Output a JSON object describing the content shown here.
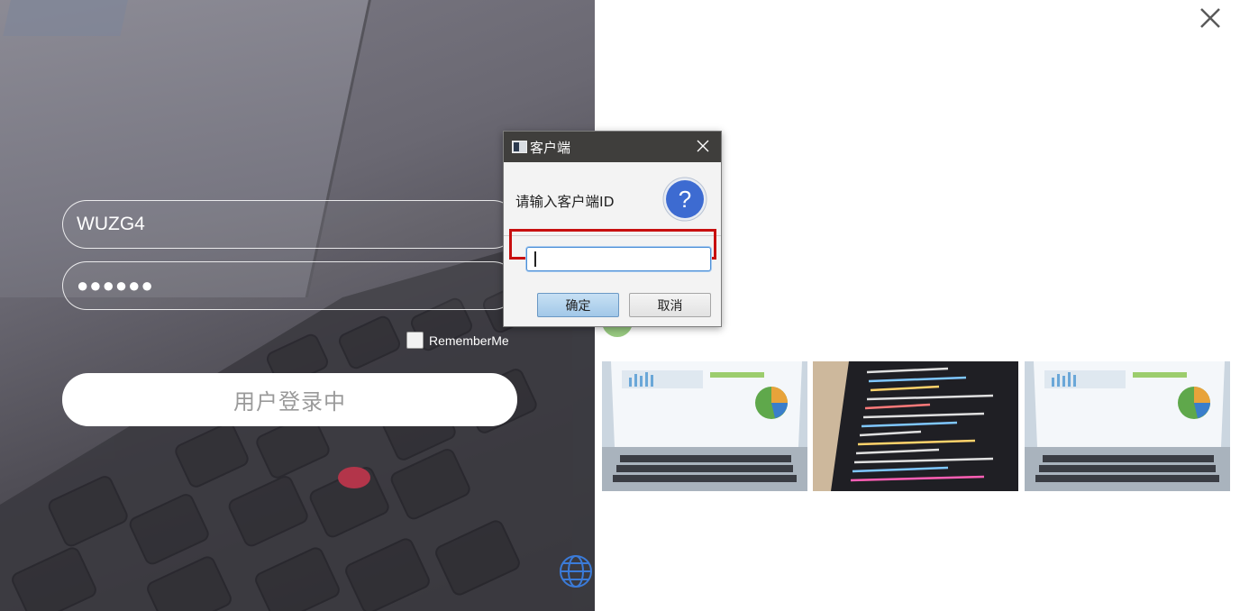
{
  "login": {
    "username_value": "WUZG4",
    "password_value": "●●●●●●",
    "remember_label": "RememberMe",
    "login_button_label": "用户登录中"
  },
  "dialog": {
    "title": "客户端",
    "message": "请输入客户端ID",
    "input_value": "",
    "ok_label": "确定",
    "cancel_label": "取消"
  },
  "icons": {
    "close": "close-icon",
    "globe": "globe-icon",
    "question": "question-icon",
    "dialog_close": "dialog-close-icon"
  },
  "colors": {
    "highlight": "#c80f0f",
    "question_blue": "#3d6bd1",
    "title_bar": "#3f3e3c"
  }
}
